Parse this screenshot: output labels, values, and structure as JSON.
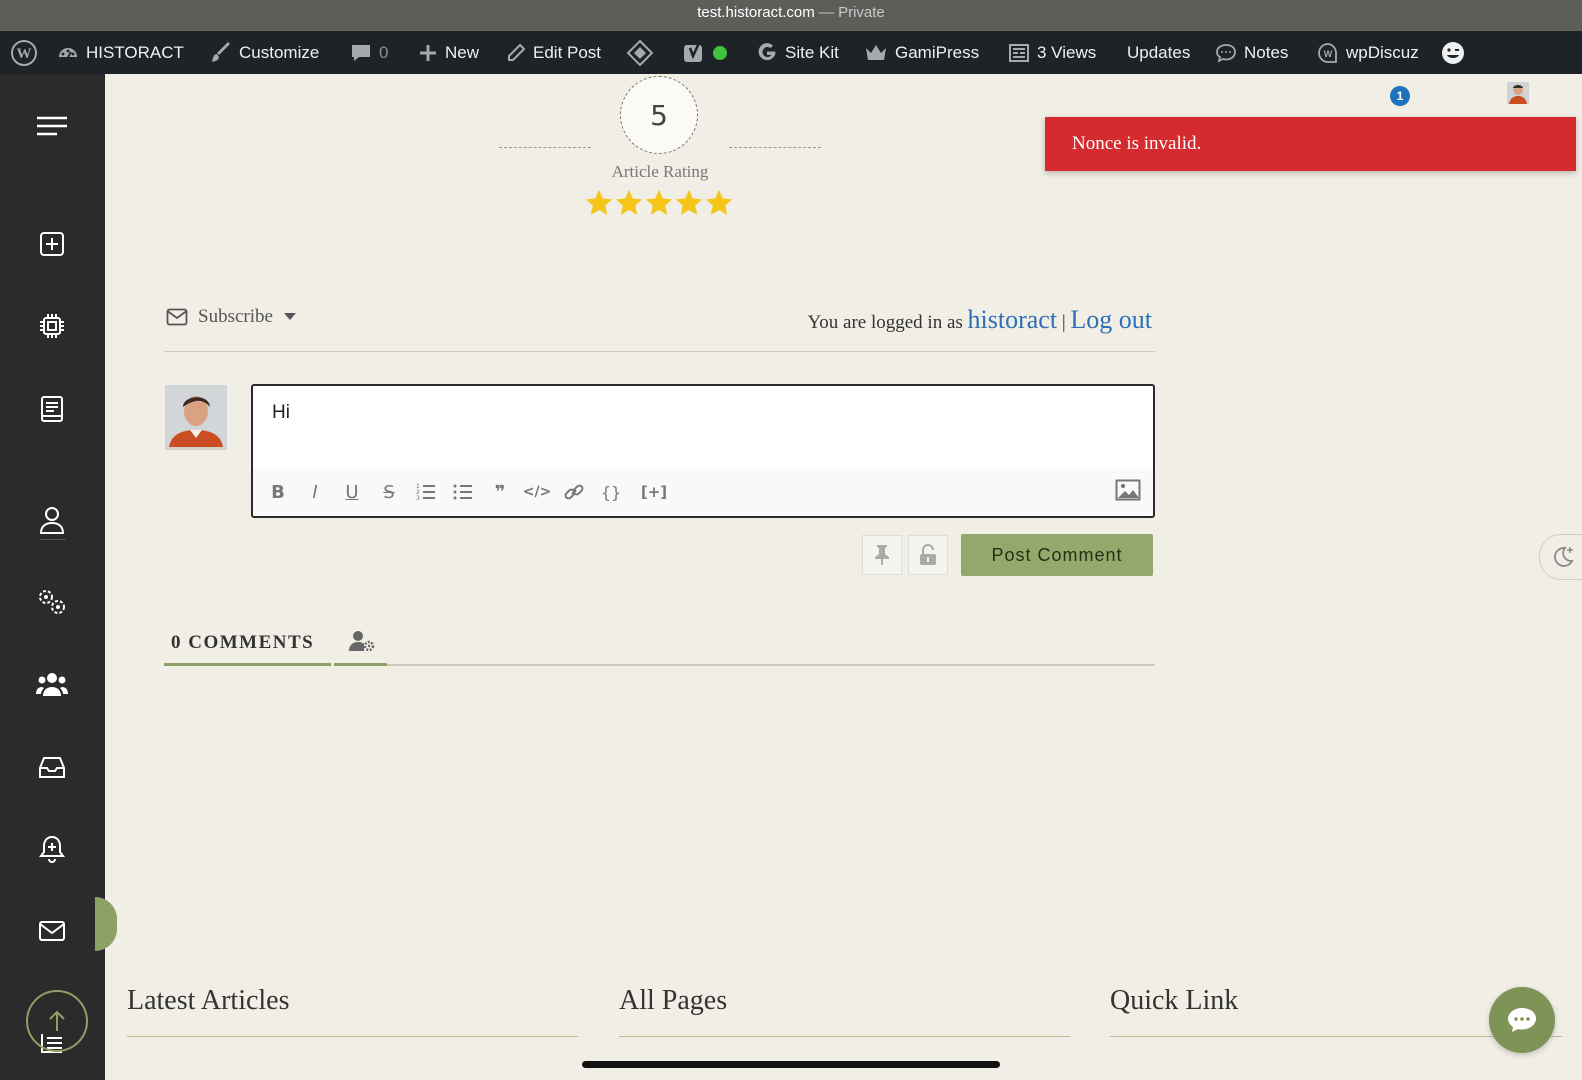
{
  "browser": {
    "url": "test.historact.com",
    "separator": " — ",
    "privacy": "Private"
  },
  "admin_bar": {
    "site_name": "HISTORACT",
    "customize": "Customize",
    "comments_count": "0",
    "new": "New",
    "edit_post": "Edit Post",
    "site_kit": "Site Kit",
    "gamipress": "GamiPress",
    "views": "3 Views",
    "updates": "Updates",
    "notes": "Notes",
    "wpdiscuz": "wpDiscuz"
  },
  "rating": {
    "value": "5",
    "label": "Article Rating",
    "stars": 5
  },
  "toast": {
    "message": "Nonce is invalid.",
    "color": "#d52b2f"
  },
  "notification_badge": "1",
  "comment_form": {
    "subscribe_label": "Subscribe",
    "login_prefix": "You are logged in as",
    "username": "historact",
    "separator": "|",
    "logout": "Log out",
    "editor_text": "Hi",
    "toolbar_buttons": [
      "bold",
      "italic",
      "underline",
      "strikethrough",
      "ordered-list",
      "unordered-list",
      "blockquote",
      "code",
      "link",
      "source-code",
      "spoiler"
    ],
    "post_button": "Post Comment"
  },
  "comments": {
    "tab_label": "0 COMMENTS"
  },
  "footer": {
    "col1_title": "Latest Articles",
    "col2_title": "All Pages",
    "col3_title": "Quick Link"
  },
  "colors": {
    "accent": "#8da164",
    "sidebar": "#2b2b2b",
    "adminbar": "#1d2327",
    "background": "#f1eee6",
    "link": "#2c6fb8"
  }
}
